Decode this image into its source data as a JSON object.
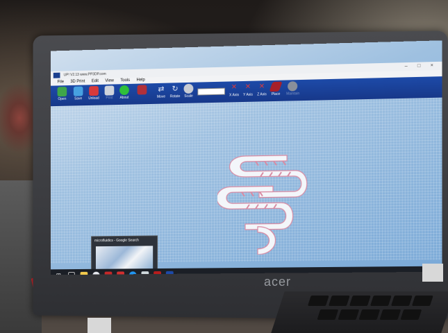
{
  "window": {
    "title": "UP! V2.13 www.PP3DP.com",
    "controls": "– □ ×"
  },
  "menu": [
    "File",
    "3D Print",
    "Edit",
    "View",
    "Tools",
    "Help"
  ],
  "toolbar": {
    "left_tools": [
      {
        "label": "Open",
        "icon": "open-icon",
        "color": "#3fa64a"
      },
      {
        "label": "Save",
        "icon": "save-icon",
        "color": "#47a1e0"
      },
      {
        "label": "Unload",
        "icon": "unload-icon",
        "color": "#d83a3a"
      },
      {
        "label": "Print",
        "icon": "printer-icon",
        "color": "#cfd4dc",
        "disabled": true
      },
      {
        "label": "About",
        "icon": "help-icon",
        "color": "#2fbf3a"
      }
    ],
    "transform_tools": [
      {
        "label": "Move",
        "icon": "move-icon"
      },
      {
        "label": "Rotate",
        "icon": "rotate-icon"
      },
      {
        "label": "Scale",
        "icon": "scale-icon"
      }
    ],
    "axis_tools": [
      {
        "label": "X Axis",
        "icon": "x-axis-icon"
      },
      {
        "label": "Y Axis",
        "icon": "y-axis-icon"
      },
      {
        "label": "Z Axis",
        "icon": "z-axis-icon"
      },
      {
        "label": "Place",
        "icon": "place-icon"
      },
      {
        "label": "Maintain",
        "icon": "maintain-icon",
        "disabled": true
      }
    ]
  },
  "taskbar_preview": {
    "title": "microfluidics - Google Search"
  },
  "colors": {
    "toolbar": "#1d4aa8",
    "viewport": "#9ec0e0",
    "model": "#f3f6fa"
  },
  "brand": "acer"
}
